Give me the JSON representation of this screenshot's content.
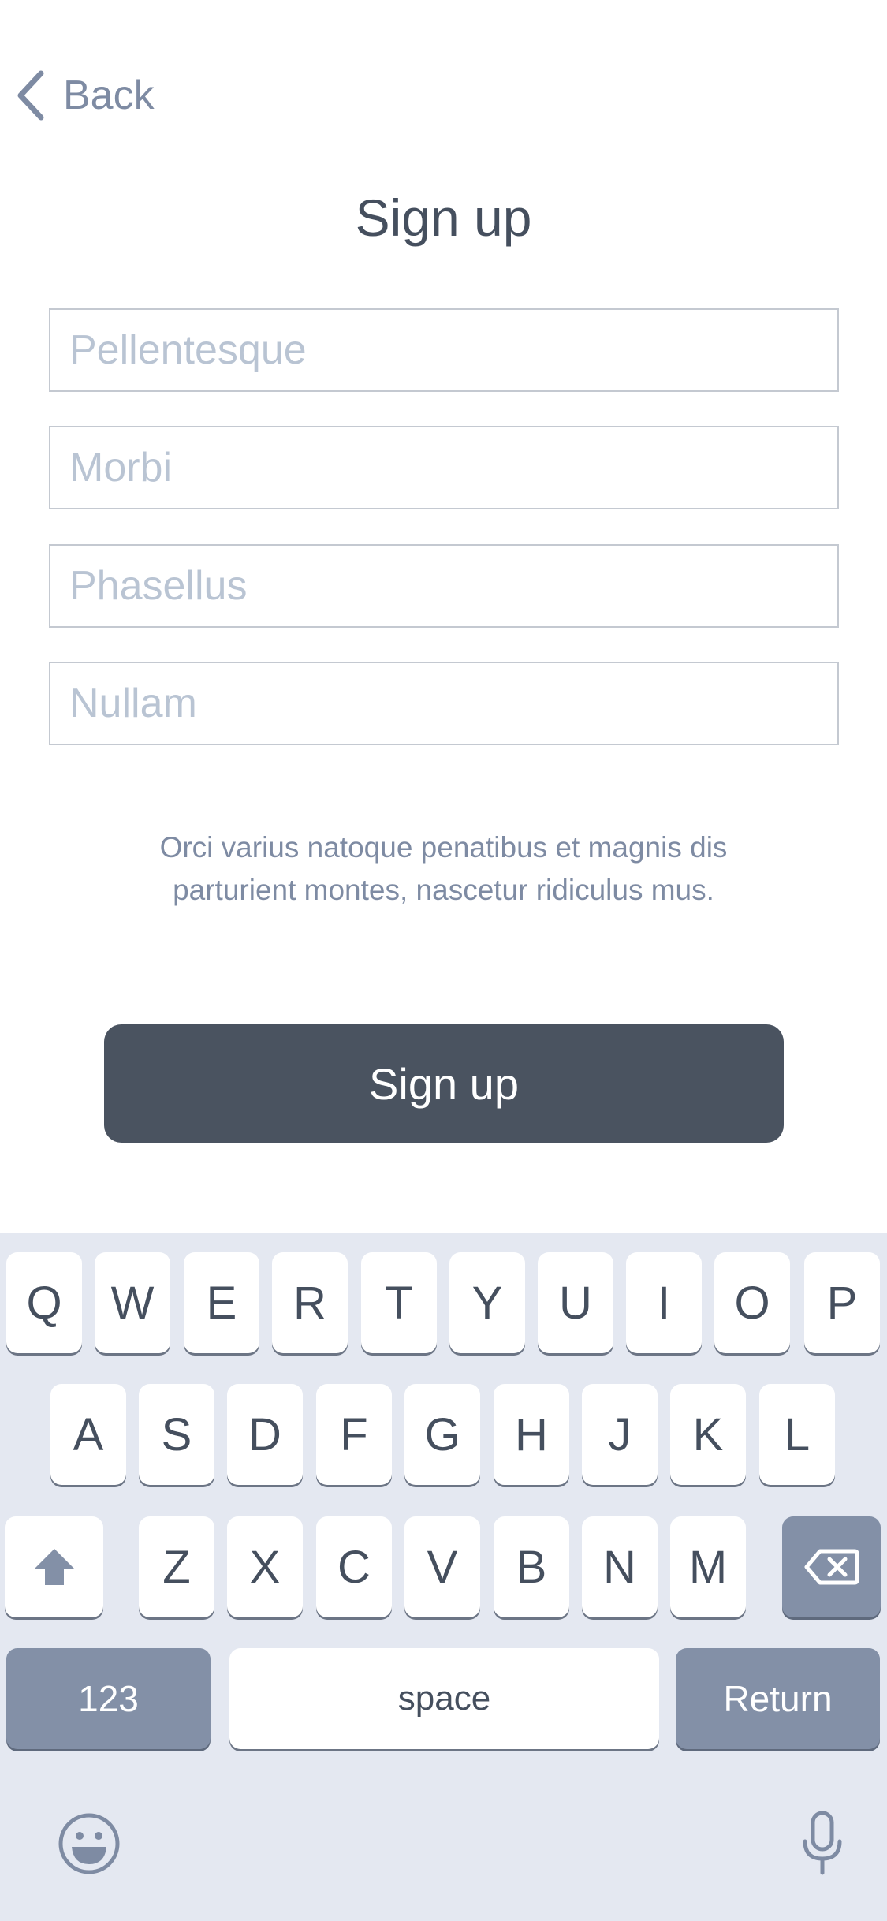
{
  "nav": {
    "back_label": "Back"
  },
  "title": "Sign up",
  "form": {
    "fields": [
      {
        "placeholder": "Pellentesque",
        "value": ""
      },
      {
        "placeholder": "Morbi",
        "value": ""
      },
      {
        "placeholder": "Phasellus",
        "value": ""
      },
      {
        "placeholder": "Nullam",
        "value": ""
      }
    ],
    "disclaimer": "Orci varius natoque penatibus et magnis dis parturient montes, nascetur ridiculus mus.",
    "submit_label": "Sign up"
  },
  "keyboard": {
    "row1": [
      "Q",
      "W",
      "E",
      "R",
      "T",
      "Y",
      "U",
      "I",
      "O",
      "P"
    ],
    "row2": [
      "A",
      "S",
      "D",
      "F",
      "G",
      "H",
      "J",
      "K",
      "L"
    ],
    "row3": [
      "Z",
      "X",
      "C",
      "V",
      "B",
      "N",
      "M"
    ],
    "numbers_label": "123",
    "space_label": "space",
    "return_label": "Return",
    "icons": {
      "shift": "shift-icon",
      "backspace": "backspace-icon",
      "emoji": "emoji-icon",
      "mic": "microphone-icon"
    }
  },
  "colors": {
    "title_text": "#454f5e",
    "muted_text": "#7e8ba3",
    "placeholder": "#b9c4d3",
    "button_bg": "#4a5360",
    "keyboard_bg": "#e4e8f1",
    "dark_key": "#8390a7"
  }
}
